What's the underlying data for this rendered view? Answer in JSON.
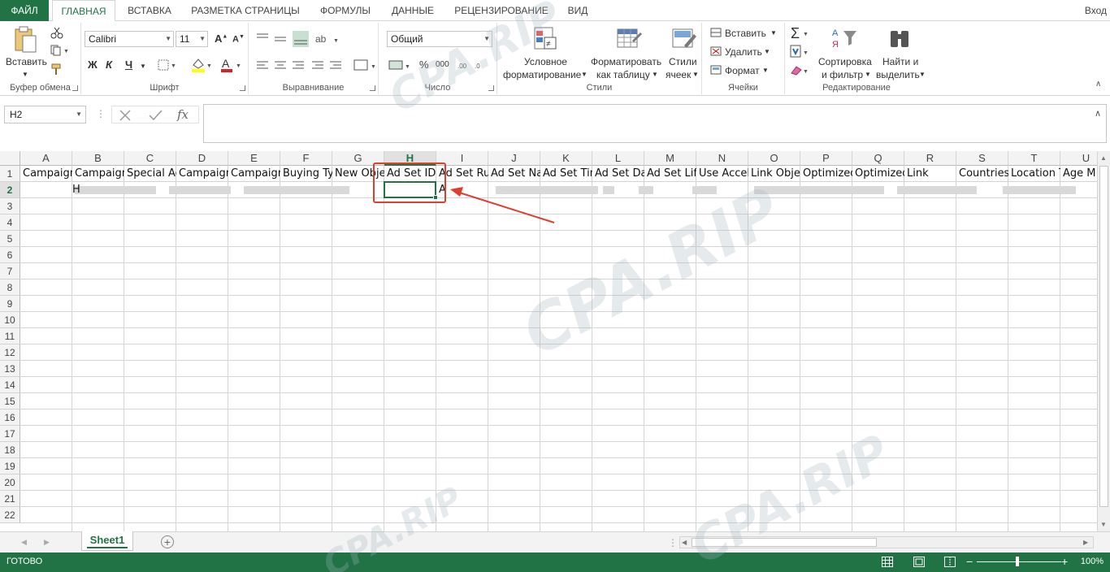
{
  "ribbon_tabs": [
    "ФАЙЛ",
    "ГЛАВНАЯ",
    "ВСТАВКА",
    "РАЗМЕТКА СТРАНИЦЫ",
    "ФОРМУЛЫ",
    "ДАННЫЕ",
    "РЕЦЕНЗИРОВАНИЕ",
    "ВИД"
  ],
  "signin": "Вход",
  "clipboard": {
    "paste": "Вставить",
    "label": "Буфер обмена"
  },
  "font": {
    "name": "Calibri",
    "size": "11",
    "bold": "Ж",
    "italic": "К",
    "underline": "Ч",
    "grow": "A",
    "shrink": "A",
    "color_letter": "А",
    "label": "Шрифт"
  },
  "alignment": {
    "label": "Выравнивание"
  },
  "number": {
    "format": "Общий",
    "percent": "%",
    "thousands": "000",
    "label": "Число"
  },
  "styles": {
    "conditional_1": "Условное",
    "conditional_2": "форматирование",
    "table_1": "Форматировать",
    "table_2": "как таблицу",
    "cell_1": "Стили",
    "cell_2": "ячеек",
    "label": "Стили"
  },
  "cells": {
    "insert": "Вставить",
    "delete": "Удалить",
    "format": "Формат",
    "label": "Ячейки"
  },
  "editing": {
    "sort_1": "Сортировка",
    "sort_2": "и фильтр",
    "find_1": "Найти и",
    "find_2": "выделить",
    "label": "Редактирование"
  },
  "formula_bar": {
    "name_box": "H2",
    "fx": "fx",
    "value": ""
  },
  "columns": [
    "A",
    "B",
    "C",
    "D",
    "E",
    "F",
    "G",
    "H",
    "I",
    "J",
    "K",
    "L",
    "M",
    "N",
    "O",
    "P",
    "Q",
    "R",
    "S",
    "T",
    "U"
  ],
  "rows": [
    "1",
    "2",
    "3",
    "4",
    "5",
    "6",
    "7",
    "8",
    "9",
    "10",
    "11",
    "12",
    "13",
    "14",
    "15",
    "16",
    "17",
    "18",
    "19",
    "20",
    "21",
    "22"
  ],
  "row1": [
    "Campaign",
    "Campaign",
    "Special Ac",
    "Campaign",
    "Campaign",
    "Buying Typ",
    "New Obje",
    "Ad Set ID",
    "Ad Set Ru",
    "Ad Set Na",
    "Ad Set Tin",
    "Ad Set Da",
    "Ad Set Life",
    "Use Accel",
    "Link Objec",
    "Optimized",
    "Optimized",
    "Link",
    "Countries",
    "Location T",
    "Age M"
  ],
  "row2_fragments": {
    "b": "H",
    "i": "A"
  },
  "selected_column": "H",
  "selected_row": "2",
  "sheet_tab": "Sheet1",
  "add_sheet": "+",
  "status": {
    "ready": "ГОТОВО",
    "zoom": "100%"
  },
  "watermark": "CPA.RIP",
  "colors": {
    "accent": "#217346",
    "highlight": "#e03e2d"
  }
}
